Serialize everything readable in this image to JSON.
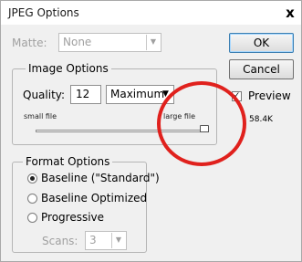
{
  "window": {
    "title": "JPEG Options",
    "close_glyph": "x"
  },
  "matte": {
    "label": "Matte:",
    "value": "None"
  },
  "buttons": {
    "ok": "OK",
    "cancel": "Cancel"
  },
  "preview": {
    "label": "Preview",
    "checked": true,
    "file_size": "58.4K"
  },
  "image_options": {
    "title": "Image Options",
    "quality_label": "Quality:",
    "quality_value": "12",
    "quality_preset": "Maximum",
    "small_file_label": "small file",
    "large_file_label": "large file",
    "slider_fraction": 1.0
  },
  "format_options": {
    "title": "Format Options",
    "options": [
      {
        "label": "Baseline (\"Standard\")",
        "selected": true
      },
      {
        "label": "Baseline Optimized",
        "selected": false
      },
      {
        "label": "Progressive",
        "selected": false
      }
    ],
    "scans_label": "Scans:",
    "scans_value": "3"
  },
  "colors": {
    "annotation_circle": "#e0211d",
    "dialog_bg": "#f0f0f0"
  },
  "icons": {
    "dropdown": "chevron-down-icon",
    "close": "close-icon",
    "annotation": "red-circle-annotation"
  }
}
